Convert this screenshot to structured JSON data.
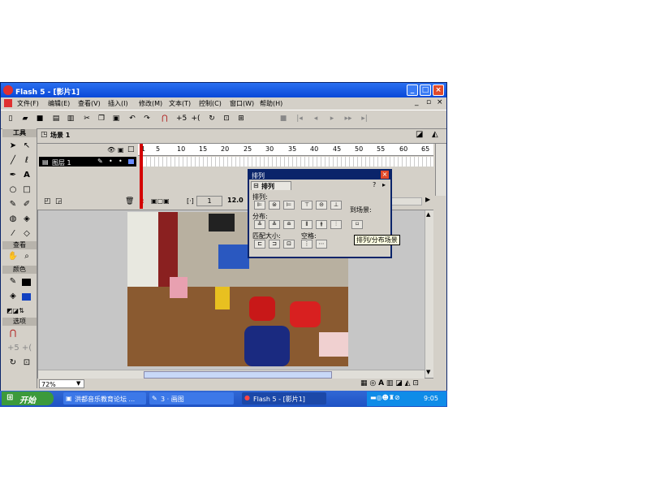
{
  "window": {
    "title": "Flash 5 - [影片1]",
    "controls": [
      "minimize",
      "maximize",
      "close"
    ]
  },
  "menu": [
    "文件(F)",
    "编辑(E)",
    "查看(V)",
    "插入(I)",
    "修改(M)",
    "文本(T)",
    "控制(C)",
    "窗口(W)",
    "帮助(H)"
  ],
  "scene": {
    "label": "场景 1"
  },
  "tools_panel": {
    "title": "工具",
    "sections": {
      "view": "查看",
      "colors": "颜色",
      "options": "选项"
    }
  },
  "timeline": {
    "frame_numbers": [
      "1",
      "5",
      "10",
      "15",
      "20",
      "25",
      "30",
      "35",
      "40",
      "45",
      "50",
      "55",
      "60",
      "65"
    ],
    "layer_name": "图层 1",
    "current_frame": "1",
    "fps": "12.0"
  },
  "stage": {
    "zoom": "72%"
  },
  "arrange_panel": {
    "title": "排列",
    "tab": "排列",
    "align_label": "排列:",
    "distribute_label": "分布:",
    "match_size_label": "匹配大小:",
    "space_label": "空格:",
    "to_stage_label": "到场景:",
    "tooltip": "排列/分布场景"
  },
  "taskbar": {
    "start": "开始",
    "items": [
      "洪都音乐教育论坛 ...",
      "3 · 画图",
      "Flash 5 - [影片1]"
    ],
    "clock": "9:05"
  },
  "colors": {
    "title_blue": "#0a49d8",
    "taskbar_blue": "#1e52c4",
    "start_green": "#3c9a3c",
    "playhead_red": "#d40000"
  }
}
